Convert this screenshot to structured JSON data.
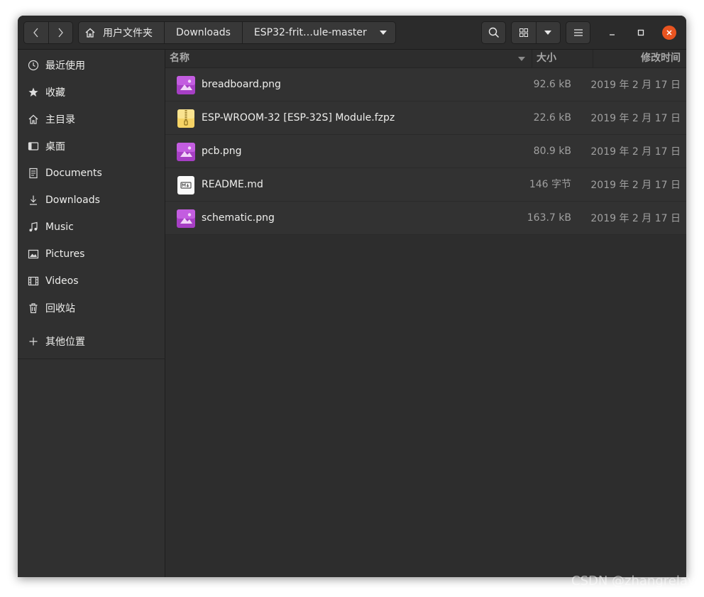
{
  "pathbar": {
    "home_label": "用户文件夹",
    "crumb_downloads": "Downloads",
    "crumb_current": "ESP32-frit…ule-master"
  },
  "sidebar": {
    "items": [
      {
        "label": "最近使用",
        "icon": "clock-icon"
      },
      {
        "label": "收藏",
        "icon": "star-icon"
      },
      {
        "label": "主目录",
        "icon": "home-icon"
      },
      {
        "label": "桌面",
        "icon": "desktop-icon"
      },
      {
        "label": "Documents",
        "icon": "document-icon"
      },
      {
        "label": "Downloads",
        "icon": "download-icon"
      },
      {
        "label": "Music",
        "icon": "music-icon"
      },
      {
        "label": "Pictures",
        "icon": "picture-icon"
      },
      {
        "label": "Videos",
        "icon": "video-icon"
      },
      {
        "label": "回收站",
        "icon": "trash-icon"
      }
    ],
    "other_locations": "其他位置"
  },
  "columns": {
    "name": "名称",
    "size": "大小",
    "modified": "修改时间"
  },
  "files": [
    {
      "name": "breadboard.png",
      "size": "92.6 kB",
      "modified": "2019 年 2 月 17 日",
      "type": "image"
    },
    {
      "name": "ESP-WROOM-32 [ESP-32S] Module.fzpz",
      "size": "22.6 kB",
      "modified": "2019 年 2 月 17 日",
      "type": "archive"
    },
    {
      "name": "pcb.png",
      "size": "80.9 kB",
      "modified": "2019 年 2 月 17 日",
      "type": "image"
    },
    {
      "name": "README.md",
      "size": "146 字节",
      "modified": "2019 年 2 月 17 日",
      "type": "markdown"
    },
    {
      "name": "schematic.png",
      "size": "163.7 kB",
      "modified": "2019 年 2 月 17 日",
      "type": "image"
    }
  ],
  "colors": {
    "accent_close": "#e95420",
    "image_icon": "#a63fc4",
    "archive_icon": "#f6d365"
  },
  "watermark": "CSDN @zhangrelay"
}
